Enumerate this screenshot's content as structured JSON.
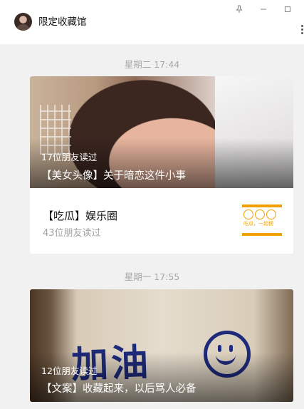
{
  "window": {
    "title": "限定收藏馆",
    "controls": {
      "pin_icon": "pin-icon",
      "minimize_icon": "minimize-icon",
      "maximize_icon": "maximize-icon"
    }
  },
  "messages": [
    {
      "timestamp": "星期二 17:44",
      "main_article": {
        "read_count": "17位朋友读过",
        "title": "【美女头像】关于暗恋这件小事"
      },
      "sub_articles": [
        {
          "title": "【吃瓜】娱乐圈",
          "read_count": "43位朋友读过",
          "thumb_text": "吃瓜，一起榜"
        }
      ]
    },
    {
      "timestamp": "星期一 17:55",
      "main_article": {
        "read_count": "12位朋友读过",
        "title": "【文案】收藏起来，以后骂人必备",
        "cover_text": "加油"
      }
    }
  ],
  "colors": {
    "background": "#f1f1f1",
    "card": "#ffffff",
    "timestamp": "#a6a6a6",
    "secondary_text": "#a3a3a3",
    "accent_orange": "#f0a100"
  }
}
